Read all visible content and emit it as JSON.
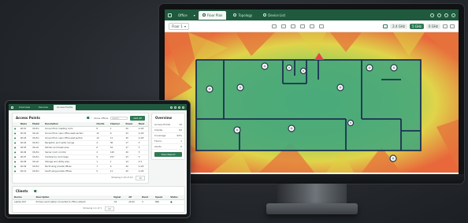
{
  "monitor_app": {
    "project_label": "Office",
    "tabs": [
      {
        "label": "Floor Plan",
        "active": true
      },
      {
        "label": "Topology",
        "active": false
      },
      {
        "label": "Device List",
        "active": false
      }
    ],
    "floor_select": "Floor 1",
    "view_toggles": [
      {
        "label": "2.4 GHz",
        "on": false
      },
      {
        "label": "5 GHz",
        "on": true
      },
      {
        "label": "6 GHz",
        "on": false
      }
    ],
    "colors": {
      "accent": "#1f5a3e",
      "coverage_good": "#3aa57a",
      "coverage_mid": "#d6d84a",
      "coverage_weak": "#e7663a"
    }
  },
  "laptop_app": {
    "tabs": [
      {
        "label": "Overview",
        "active": false
      },
      {
        "label": "Devices",
        "active": false
      },
      {
        "label": "Access Points",
        "active": true
      }
    ],
    "ap_card": {
      "title": "Access Points",
      "search_placeholder": "Search",
      "toggle_label": "Show offline",
      "add_button": "Add AP",
      "columns": [
        "",
        "Name",
        "Model",
        "Description",
        "Clients",
        "Channel",
        "Power",
        "Band"
      ],
      "rows": [
        [
          "●",
          "AP-01",
          "U6-Pro",
          "Ground floor meeting room",
          "8",
          "1",
          "20",
          "2.4/5"
        ],
        [
          "●",
          "AP-02",
          "U6-LR",
          "Ground floor open office west section",
          "12",
          "6",
          "23",
          "2.4/5"
        ],
        [
          "●",
          "AP-03",
          "U6-Pro",
          "Ground floor open office east section",
          "10",
          "11",
          "20",
          "2.4/5"
        ],
        [
          "●",
          "AP-04",
          "U6-Pro",
          "Reception and visitor lounge",
          "4",
          "36",
          "17",
          "5"
        ],
        [
          "●",
          "AP-05",
          "U6-LR",
          "Kitchen and break area",
          "6",
          "44",
          "17",
          "5"
        ],
        [
          "●",
          "AP-06",
          "U6-Pro",
          "Server room corridor",
          "2",
          "149",
          "20",
          "5"
        ],
        [
          "●",
          "AP-07",
          "U6-Pro",
          "Conference room large",
          "9",
          "157",
          "23",
          "5"
        ],
        [
          "●",
          "AP-08",
          "U6-LR",
          "Storage and utility area",
          "1",
          "1",
          "14",
          "2.4"
        ],
        [
          "●",
          "AP-09",
          "U6-Pro",
          "North wing private offices",
          "7",
          "6",
          "20",
          "2.4/5"
        ],
        [
          "●",
          "AP-10",
          "U6-Pro",
          "South wing private offices",
          "5",
          "11",
          "20",
          "2.4/5"
        ]
      ],
      "footer": "Showing 1-10 of 10",
      "page_size": "10"
    },
    "overview_card": {
      "title": "Overview",
      "items": [
        {
          "label": "Access Points",
          "value": "10"
        },
        {
          "label": "Clients",
          "value": "64"
        },
        {
          "label": "Coverage",
          "value": "92%"
        },
        {
          "label": "Floors",
          "value": "1"
        },
        {
          "label": "Alerts",
          "value": "0"
        }
      ],
      "button": "View Report"
    },
    "clients_card": {
      "title": "Clients",
      "columns": [
        "Device",
        "Description",
        "Signal",
        "AP",
        "Band",
        "Speed",
        "Status"
      ],
      "rows": [
        [
          "Laptop-104",
          "Primary work laptop connected to office network",
          "-52",
          "AP-02",
          "5",
          "866",
          "●"
        ]
      ],
      "footer": "Showing 1-1 of 1",
      "page_size": "10"
    }
  }
}
